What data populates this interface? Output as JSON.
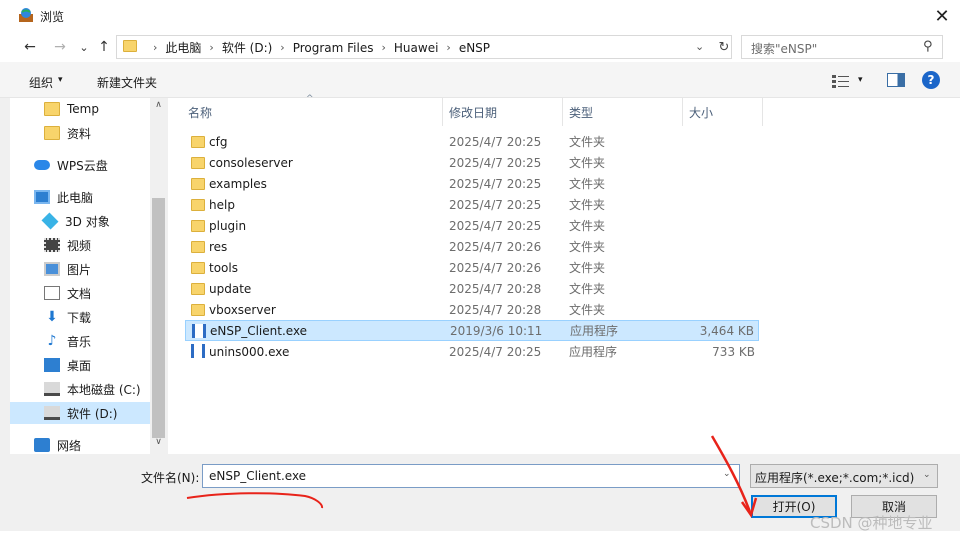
{
  "window": {
    "title": "浏览",
    "close": "✕"
  },
  "nav": {
    "back": "←",
    "forward": "→",
    "recent": "⌄",
    "up": "↑",
    "refresh": "↻"
  },
  "address": {
    "crumbs": [
      "此电脑",
      "软件 (D:)",
      "Program Files",
      "Huawei",
      "eNSP"
    ],
    "separator": "›",
    "dropdown": "⌄"
  },
  "search": {
    "placeholder": "搜索\"eNSP\"",
    "icon": "⚲"
  },
  "toolbar": {
    "organize": "组织",
    "caret": "▾",
    "new_folder": "新建文件夹",
    "help": "?"
  },
  "sidebar": {
    "items": [
      {
        "label": "Temp",
        "icon": "folder-icon"
      },
      {
        "label": "资料",
        "icon": "folder-icon"
      },
      {
        "label": "WPS云盘",
        "icon": "cloud-icon"
      },
      {
        "label": "此电脑",
        "icon": "computer-icon"
      },
      {
        "label": "3D 对象",
        "icon": "3d-objects-icon"
      },
      {
        "label": "视频",
        "icon": "video-icon"
      },
      {
        "label": "图片",
        "icon": "pictures-icon"
      },
      {
        "label": "文档",
        "icon": "documents-icon"
      },
      {
        "label": "下载",
        "icon": "download-icon"
      },
      {
        "label": "音乐",
        "icon": "music-icon"
      },
      {
        "label": "桌面",
        "icon": "desktop-icon"
      },
      {
        "label": "本地磁盘 (C:)",
        "icon": "drive-icon"
      },
      {
        "label": "软件 (D:)",
        "icon": "drive-icon",
        "selected": true
      },
      {
        "label": "网络",
        "icon": "network-icon"
      }
    ],
    "scroll_up": "∧",
    "scroll_down": "∨"
  },
  "columns": {
    "name": "名称",
    "date": "修改日期",
    "type": "类型",
    "size": "大小",
    "sort": "^"
  },
  "files": [
    {
      "name": "cfg",
      "date": "2025/4/7 20:25",
      "type": "文件夹",
      "size": "",
      "kind": "folder"
    },
    {
      "name": "consoleserver",
      "date": "2025/4/7 20:25",
      "type": "文件夹",
      "size": "",
      "kind": "folder"
    },
    {
      "name": "examples",
      "date": "2025/4/7 20:25",
      "type": "文件夹",
      "size": "",
      "kind": "folder"
    },
    {
      "name": "help",
      "date": "2025/4/7 20:25",
      "type": "文件夹",
      "size": "",
      "kind": "folder"
    },
    {
      "name": "plugin",
      "date": "2025/4/7 20:25",
      "type": "文件夹",
      "size": "",
      "kind": "folder"
    },
    {
      "name": "res",
      "date": "2025/4/7 20:26",
      "type": "文件夹",
      "size": "",
      "kind": "folder"
    },
    {
      "name": "tools",
      "date": "2025/4/7 20:26",
      "type": "文件夹",
      "size": "",
      "kind": "folder"
    },
    {
      "name": "update",
      "date": "2025/4/7 20:28",
      "type": "文件夹",
      "size": "",
      "kind": "folder"
    },
    {
      "name": "vboxserver",
      "date": "2025/4/7 20:28",
      "type": "文件夹",
      "size": "",
      "kind": "folder"
    },
    {
      "name": "eNSP_Client.exe",
      "date": "2019/3/6 10:11",
      "type": "应用程序",
      "size": "3,464 KB",
      "kind": "exe",
      "selected": true
    },
    {
      "name": "unins000.exe",
      "date": "2025/4/7 20:25",
      "type": "应用程序",
      "size": "733 KB",
      "kind": "exe"
    }
  ],
  "footer": {
    "filename_label": "文件名(N):",
    "filename_value": "eNSP_Client.exe",
    "filter_value": "应用程序(*.exe;*.com;*.icd)",
    "dropdown": "⌄",
    "open_label": "打开(O)",
    "cancel_label": "取消"
  },
  "watermark": "CSDN @种地专业",
  "colors": {
    "selection": "#cce8ff",
    "annotation_red": "#e8231a",
    "accent": "#0078d7"
  }
}
